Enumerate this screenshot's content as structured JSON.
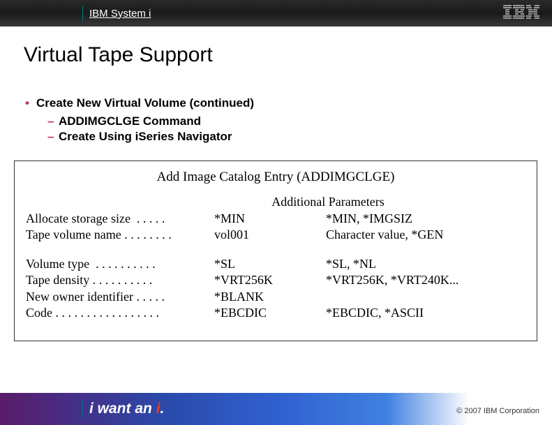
{
  "header": {
    "system_label": "IBM System i",
    "logo_text": "IBM"
  },
  "title": "Virtual Tape Support",
  "bullets": {
    "main": "Create New Virtual Volume  (continued)",
    "sub1": "ADDIMGCLGE Command",
    "sub2": "Create Using iSeries Navigator"
  },
  "panel": {
    "title": "Add Image Catalog Entry (ADDIMGCLGE)",
    "subtitle": "Additional Parameters",
    "rows": [
      {
        "label": "Allocate storage size  . . . . .",
        "value": "*MIN",
        "options": "*MIN, *IMGSIZ"
      },
      {
        "label": "Tape volume name . . . . . . . .",
        "value": "vol001",
        "options": "Character value, *GEN"
      }
    ],
    "rows2": [
      {
        "label": "Volume type  . . . . . . . . . .",
        "value": "*SL",
        "options": "*SL, *NL"
      },
      {
        "label": "Tape density . . . . . . . . . .",
        "value": "*VRT256K",
        "options": "*VRT256K, *VRT240K..."
      },
      {
        "label": "New owner identifier . . . . .",
        "value": "*BLANK",
        "options": ""
      },
      {
        "label": "Code . . . . . . . . . . . . . . . . .",
        "value": "*EBCDIC",
        "options": "*EBCDIC, *ASCII"
      }
    ]
  },
  "footer": {
    "slogan_pre": "i want an ",
    "slogan_accent": "i",
    "slogan_post": ".",
    "copyright": "© 2007 IBM Corporation"
  }
}
